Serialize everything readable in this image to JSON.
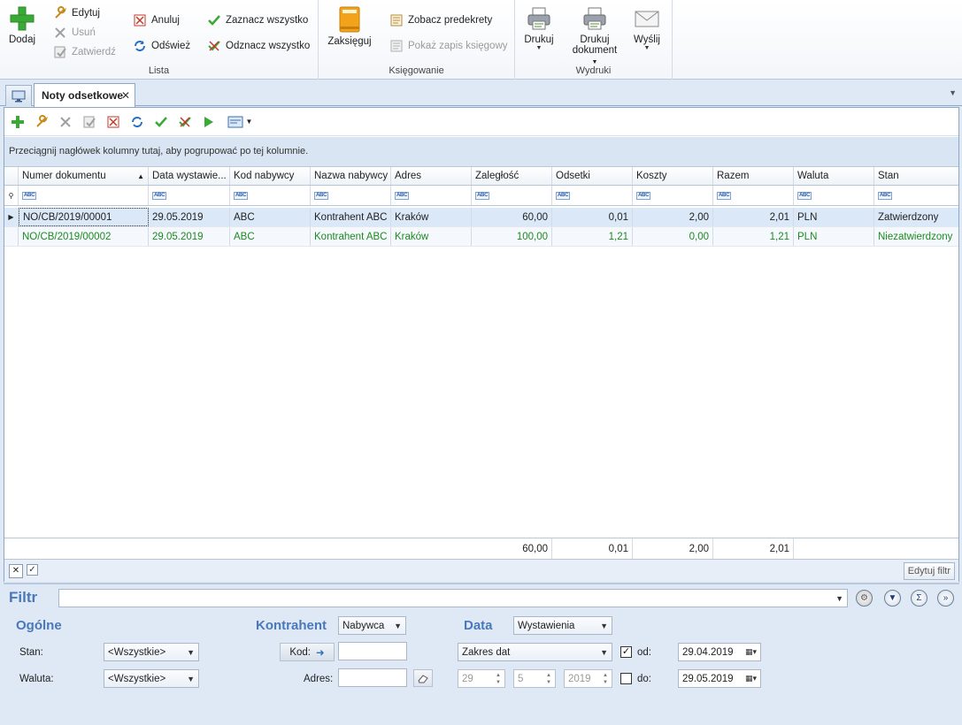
{
  "ribbon": {
    "add_label": "Dodaj",
    "edit_label": "Edytuj",
    "delete_label": "Usuń",
    "approve_label": "Zatwierdź",
    "cancel_label": "Anuluj",
    "refresh_label": "Odśwież",
    "select_all_label": "Zaznacz wszystko",
    "deselect_all_label": "Odznacz wszystko",
    "group_list": "Lista",
    "post_label": "Zaksięguj",
    "view_predecrees_label": "Zobacz predekrety",
    "show_record_label": "Pokaż zapis księgowy",
    "group_accounting": "Księgowanie",
    "print_label": "Drukuj",
    "print_doc_label_1": "Drukuj",
    "print_doc_label_2": "dokument",
    "send_label": "Wyślij",
    "group_printouts": "Wydruki"
  },
  "tab": {
    "title": "Noty odsetkowe",
    "close": "✕"
  },
  "grid": {
    "group_hint": "Przeciągnij nagłówek kolumny tutaj, aby pogrupować po tej kolumnie.",
    "columns": [
      "Numer dokumentu",
      "Data wystawie...",
      "Kod nabywcy",
      "Nazwa nabywcy",
      "Adres",
      "Zaległość",
      "Odsetki",
      "Koszty",
      "Razem",
      "Waluta",
      "Stan"
    ],
    "rows": [
      [
        "NO/CB/2019/00001",
        "29.05.2019",
        "ABC",
        "Kontrahent ABC",
        "Kraków",
        "60,00",
        "0,01",
        "2,00",
        "2,01",
        "PLN",
        "Zatwierdzony"
      ],
      [
        "NO/CB/2019/00002",
        "29.05.2019",
        "ABC",
        "Kontrahent ABC",
        "Kraków",
        "100,00",
        "1,21",
        "0,00",
        "1,21",
        "PLN",
        "Niezatwierdzony"
      ]
    ],
    "totals": {
      "zaleglosc": "60,00",
      "odsetki": "0,01",
      "koszty": "2,00",
      "razem": "2,01"
    },
    "edit_filter_label": "Edytuj filtr"
  },
  "filter": {
    "title": "Filtr",
    "general_title": "Ogólne",
    "status_label": "Stan:",
    "status_value": "<Wszystkie>",
    "currency_label": "Waluta:",
    "currency_value": "<Wszystkie>",
    "contractor_title": "Kontrahent",
    "contractor_type": "Nabywca",
    "code_label": "Kod:",
    "code_value": "",
    "address_label": "Adres:",
    "address_value": "",
    "date_title": "Data",
    "date_type": "Wystawienia",
    "range_type": "Zakres dat",
    "day": "29",
    "month": "5",
    "year": "2019",
    "from_label": "od:",
    "from_value": "29.04.2019",
    "to_label": "do:",
    "to_value": "29.05.2019",
    "from_checked": true,
    "to_checked": false
  }
}
